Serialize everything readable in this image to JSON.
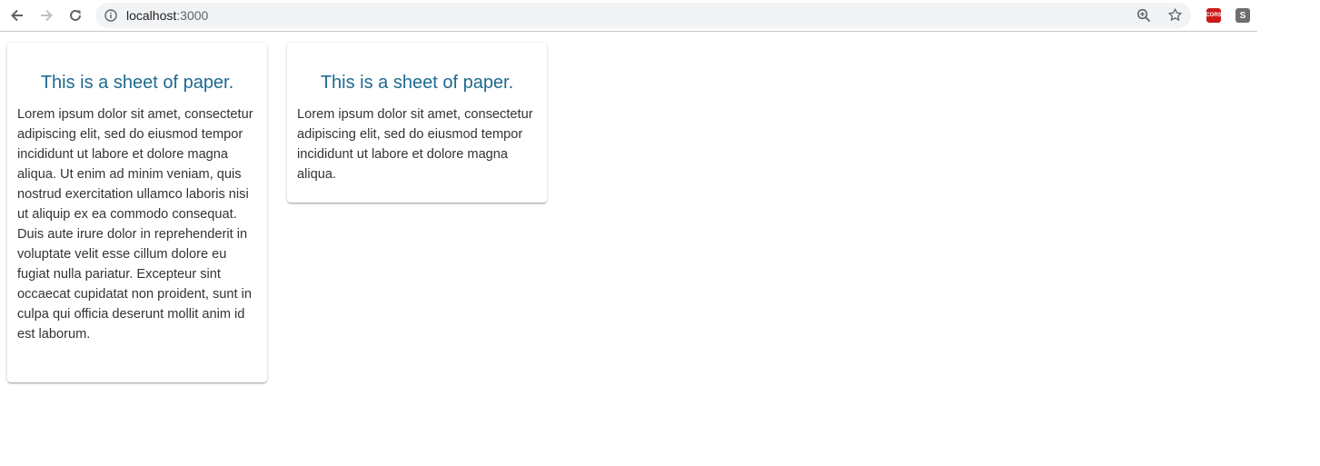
{
  "browser": {
    "url_host": "localhost",
    "url_port": ":3000",
    "extensions": [
      {
        "name": "cors",
        "label": "CORS",
        "color": "#cc1a1a"
      },
      {
        "name": "s",
        "label": "S",
        "color": "#6e6e6e"
      }
    ]
  },
  "papers": [
    {
      "heading": "This is a sheet of paper.",
      "body": "Lorem ipsum dolor sit amet, consectetur adipiscing elit, sed do eiusmod tempor incididunt ut labore et dolore magna aliqua. Ut enim ad minim veniam, quis nostrud exercitation ullamco laboris nisi ut aliquip ex ea commodo consequat. Duis aute irure dolor in reprehenderit in voluptate velit esse cillum dolore eu fugiat nulla pariatur. Excepteur sint occaecat cupidatat non proident, sunt in culpa qui officia deserunt mollit anim id est laborum."
    },
    {
      "heading": "This is a sheet of paper.",
      "body": "Lorem ipsum dolor sit amet, consectetur adipiscing elit, sed do eiusmod tempor incididunt ut labore et dolore magna aliqua."
    }
  ],
  "colors": {
    "heading": "#1d6a8f",
    "body_text": "#333333"
  }
}
